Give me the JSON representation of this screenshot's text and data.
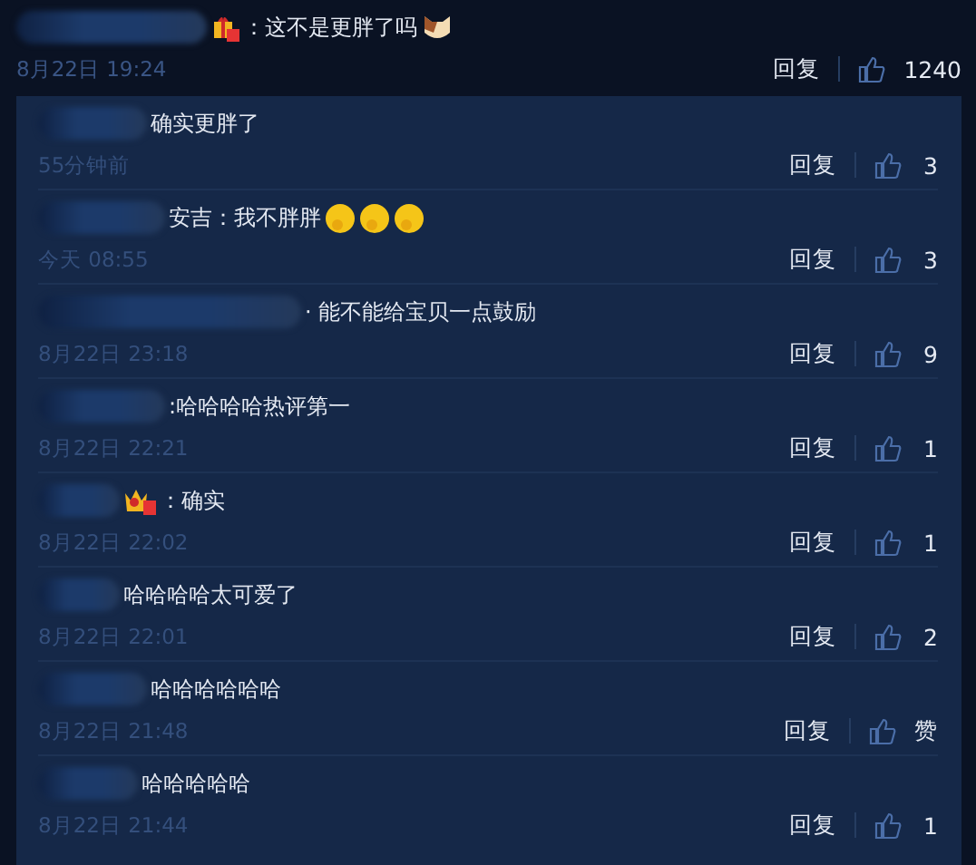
{
  "comment": {
    "badge": {
      "kind": "gift"
    },
    "text": "：这不是更胖了吗",
    "emojis": [
      {
        "kind": "cat"
      }
    ],
    "time": "8月22日 19:24",
    "reply": "回复",
    "likes": "1240"
  },
  "replies": [
    {
      "text": "确实更胖了",
      "time": "55分钟前",
      "reply": "回复",
      "likes": "3"
    },
    {
      "text": "安吉：我不胖胖",
      "emojis": [
        {
          "kind": "blush"
        },
        {
          "kind": "blush"
        },
        {
          "kind": "blush"
        }
      ],
      "time": "今天 08:55",
      "reply": "回复",
      "likes": "3"
    },
    {
      "text": "· 能不能给宝贝一点鼓励",
      "time": "8月22日 23:18",
      "reply": "回复",
      "likes": "9"
    },
    {
      "text": ":哈哈哈哈热评第一",
      "time": "8月22日 22:21",
      "reply": "回复",
      "likes": "1"
    },
    {
      "badge": {
        "kind": "crown"
      },
      "text": "：确实",
      "time": "8月22日 22:02",
      "reply": "回复",
      "likes": "1"
    },
    {
      "text": "哈哈哈哈太可爱了",
      "time": "8月22日 22:01",
      "reply": "回复",
      "likes": "2"
    },
    {
      "text": "哈哈哈哈哈哈",
      "time": "8月22日 21:48",
      "reply": "回复",
      "likes": "赞"
    },
    {
      "text": "哈哈哈哈哈",
      "time": "8月22日 21:44",
      "reply": "回复",
      "likes": "1"
    }
  ]
}
